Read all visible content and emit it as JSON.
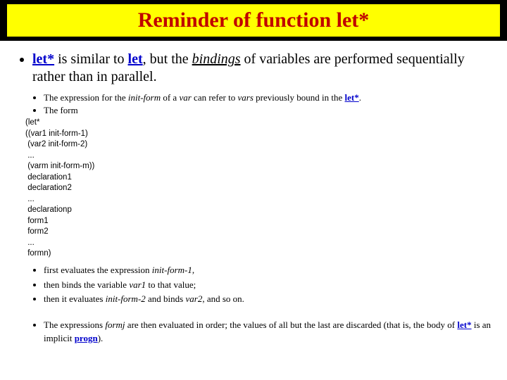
{
  "title": "Reminder of function let*",
  "main": {
    "letstar": "let*",
    "text1": " is similar to ",
    "let": "let",
    "text2": ", but the ",
    "bindings": "bindings",
    "text3": " of variables are performed sequentially rather than in parallel."
  },
  "sub1": {
    "a_pre": "The expression for the ",
    "a_initform": "init-form",
    "a_mid1": " of a ",
    "a_var": "var",
    "a_mid2": " can refer to ",
    "a_vars": "vars",
    "a_mid3": " previously bound in the ",
    "a_letstar": "let*",
    "a_end": ".",
    "b": "The form"
  },
  "code": {
    "l0": "(let*",
    "l1": "((var1 init-form-1)",
    "l2": " (var2 init-form-2)",
    "l3": " ...",
    "l4": " (varm init-form-m))",
    "l5": " declaration1",
    "l6": " declaration2",
    "l7": " ...",
    "l8": " declarationp",
    "l9": " form1",
    "l10": " form2",
    "l11": " ...",
    "l12": " formn)"
  },
  "after": {
    "a_pre": "first evaluates the expression ",
    "a_initform1": "init-form-1",
    "a_end": ",",
    "b_pre": "then binds the variable ",
    "b_var1": "var1",
    "b_end": " to that value;",
    "c_pre": "then it evaluates ",
    "c_initform2": "init-form-2",
    "c_mid": " and binds ",
    "c_var2": "var2",
    "c_end": ", and so on.",
    "d_pre": "The expressions ",
    "d_formj": "formj",
    "d_mid": " are then evaluated in order; the values of all but the last are discarded (that is, the body of ",
    "d_letstar": "let*",
    "d_mid2": " is an implicit ",
    "d_progn": "progn",
    "d_end": ")."
  }
}
